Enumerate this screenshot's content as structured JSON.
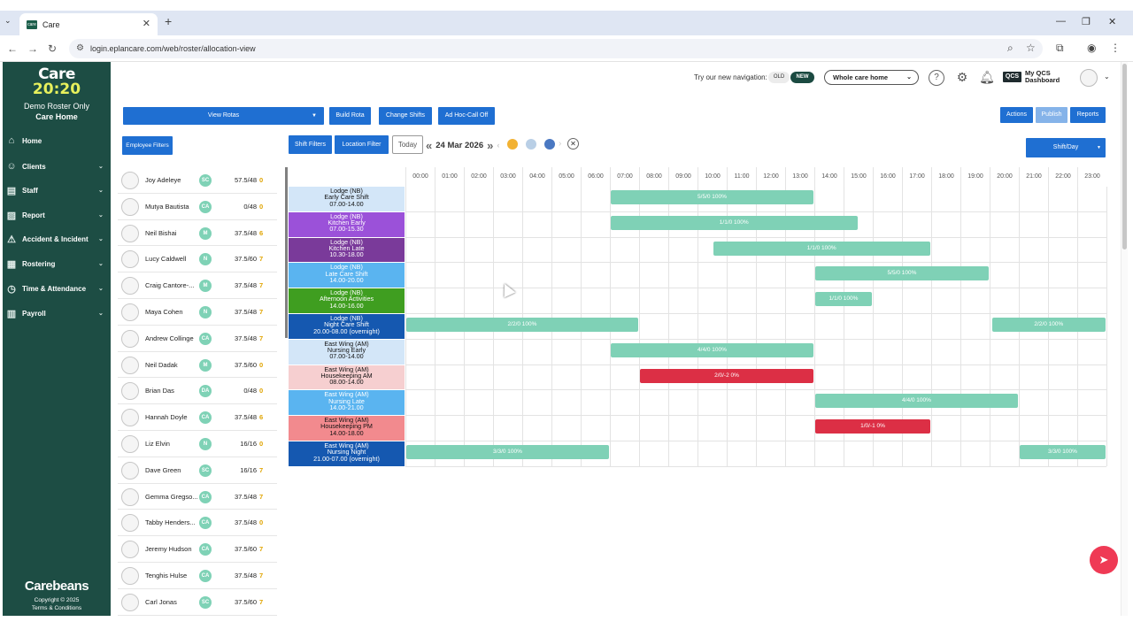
{
  "browser": {
    "tab_title": "Care",
    "favicon_text": "care",
    "url": "login.eplancare.com/web/roster/allocation-view"
  },
  "sidebar": {
    "logo_line1": "Care",
    "logo_line2_a": "20",
    "logo_line2_sep": ":",
    "logo_line2_b": "20",
    "org_line1": "Demo Roster Only",
    "org_line2": "Care Home",
    "items": [
      {
        "label": "Home",
        "icon": "home-icon",
        "chevron": false
      },
      {
        "label": "Clients",
        "icon": "clients-icon",
        "chevron": true
      },
      {
        "label": "Staff",
        "icon": "staff-icon",
        "chevron": true
      },
      {
        "label": "Report",
        "icon": "report-icon",
        "chevron": true
      },
      {
        "label": "Accident & Incident",
        "icon": "incident-icon",
        "chevron": true
      },
      {
        "label": "Rostering",
        "icon": "rostering-icon",
        "chevron": true
      },
      {
        "label": "Time & Attendance",
        "icon": "clock-icon",
        "chevron": true
      },
      {
        "label": "Payroll",
        "icon": "payroll-icon",
        "chevron": true
      }
    ],
    "brand": "Carebeans",
    "copyright": "Copyright © 2025",
    "terms": "Terms & Conditions"
  },
  "header": {
    "nav_prompt": "Try our new navigation:",
    "toggle_old": "OLD",
    "toggle_new": "NEW",
    "care_home_select": "Whole care home",
    "qcs_badge": "QCS",
    "qcs_label_1": "My QCS",
    "qcs_label_2": "Dashboard"
  },
  "toolbar": {
    "view_rotas": "View Rotas",
    "build_rota": "Build Rota",
    "change_shifts": "Change Shifts",
    "adhoc": "Ad Hoc-Call Off",
    "actions": "Actions",
    "publish": "Publish",
    "reports": "Reports",
    "employee_filters": "Employee Filters",
    "shift_filters": "Shift Filters",
    "location_filter": "Location Filter",
    "today": "Today",
    "date": "24 Mar 2026",
    "view_mode": "Shift/Day"
  },
  "dots": [
    {
      "color": "#f2b233"
    },
    {
      "color": "#b9cfe6"
    },
    {
      "color": "#4a78c2"
    }
  ],
  "staff": [
    {
      "name": "Joy Adeleye",
      "role": "SC",
      "hours": "57.5/48",
      "count": "0"
    },
    {
      "name": "Mutya Bautista",
      "role": "CA",
      "hours": "0/48",
      "count": "0"
    },
    {
      "name": "Neil Bishai",
      "role": "M",
      "hours": "37.5/48",
      "count": "6"
    },
    {
      "name": "Lucy Caldwell",
      "role": "N",
      "hours": "37.5/60",
      "count": "7"
    },
    {
      "name": "Craig Cantore-...",
      "role": "M",
      "hours": "37.5/48",
      "count": "7"
    },
    {
      "name": "Maya Cohen",
      "role": "N",
      "hours": "37.5/48",
      "count": "7"
    },
    {
      "name": "Andrew Collinge",
      "role": "CA",
      "hours": "37.5/48",
      "count": "7"
    },
    {
      "name": "Neil Dadak",
      "role": "M",
      "hours": "37.5/60",
      "count": "0"
    },
    {
      "name": "Brian Das",
      "role": "DA",
      "hours": "0/48",
      "count": "0"
    },
    {
      "name": "Hannah Doyle",
      "role": "CA",
      "hours": "37.5/48",
      "count": "6"
    },
    {
      "name": "Liz Elvin",
      "role": "N",
      "hours": "16/16",
      "count": "0"
    },
    {
      "name": "Dave Green",
      "role": "SC",
      "hours": "16/16",
      "count": "7"
    },
    {
      "name": "Gemma Gregso...",
      "role": "CA",
      "hours": "37.5/48",
      "count": "7"
    },
    {
      "name": "Tabby Henders...",
      "role": "CA",
      "hours": "37.5/48",
      "count": "0"
    },
    {
      "name": "Jeremy Hudson",
      "role": "CA",
      "hours": "37.5/60",
      "count": "7"
    },
    {
      "name": "Tenghis Hulse",
      "role": "CA",
      "hours": "37.5/48",
      "count": "7"
    },
    {
      "name": "Carl Jonas",
      "role": "SC",
      "hours": "37.5/60",
      "count": "7"
    }
  ],
  "hours": [
    "00:00",
    "01:00",
    "02:00",
    "03:00",
    "04:00",
    "05:00",
    "06:00",
    "07:00",
    "08:00",
    "09:00",
    "10:00",
    "11:00",
    "12:00",
    "13:00",
    "14:00",
    "15:00",
    "16:00",
    "17:00",
    "18:00",
    "19:00",
    "20:00",
    "21:00",
    "22:00",
    "23:00"
  ],
  "shifts": [
    {
      "line1": "Lodge (NB)",
      "line2": "Early Care Shift",
      "line3": "07.00-14.00",
      "bg": "#d3e6f8",
      "fg": "#111",
      "bars": [
        {
          "start": 7,
          "end": 14,
          "label": "5/5/0 100%",
          "status": "ok"
        }
      ]
    },
    {
      "line1": "Lodge (NB)",
      "line2": "Kitchen Early",
      "line3": "07.00-15.30",
      "bg": "#9b51d9",
      "fg": "#fff",
      "bars": [
        {
          "start": 7,
          "end": 15.5,
          "label": "1/1/0 100%",
          "status": "ok"
        }
      ]
    },
    {
      "line1": "Lodge (NB)",
      "line2": "Kitchen Late",
      "line3": "10.30-18.00",
      "bg": "#7a3a9a",
      "fg": "#fff",
      "bars": [
        {
          "start": 10.5,
          "end": 18,
          "label": "1/1/0 100%",
          "status": "ok"
        }
      ]
    },
    {
      "line1": "Lodge (NB)",
      "line2": "Late Care Shift",
      "line3": "14.00-20.00",
      "bg": "#5ab4f0",
      "fg": "#fff",
      "bars": [
        {
          "start": 14,
          "end": 20,
          "label": "5/5/0 100%",
          "status": "ok"
        }
      ]
    },
    {
      "line1": "Lodge (NB)",
      "line2": "Afternoon Activities",
      "line3": "14.00-16.00",
      "bg": "#3f9e20",
      "fg": "#fff",
      "bars": [
        {
          "start": 14,
          "end": 16,
          "label": "1/1/0 100%",
          "status": "ok"
        }
      ]
    },
    {
      "line1": "Lodge (NB)",
      "line2": "Night Care Shift",
      "line3": "20.00-08.00 (overnight)",
      "bg": "#1558b0",
      "fg": "#fff",
      "bars": [
        {
          "start": 0,
          "end": 8,
          "label": "2/2/0 100%",
          "status": "ok"
        },
        {
          "start": 20.05,
          "end": 24,
          "label": "2/2/0 100%",
          "status": "ok"
        }
      ]
    },
    {
      "line1": "East Wing (AM)",
      "line2": "Nursing Early",
      "line3": "07.00-14.00",
      "bg": "#d3e6f8",
      "fg": "#111",
      "bars": [
        {
          "start": 7,
          "end": 14,
          "label": "4/4/0 100%",
          "status": "ok"
        }
      ]
    },
    {
      "line1": "East Wing (AM)",
      "line2": "Housekeeping AM",
      "line3": "08.00-14.00",
      "bg": "#f6cfd0",
      "fg": "#111",
      "bars": [
        {
          "start": 8,
          "end": 14,
          "label": "2/0/-2 0%",
          "status": "bad"
        }
      ]
    },
    {
      "line1": "East Wing (AM)",
      "line2": "Nursing Late",
      "line3": "14.00-21.00",
      "bg": "#5ab4f0",
      "fg": "#fff",
      "bars": [
        {
          "start": 14,
          "end": 21,
          "label": "4/4/0 100%",
          "status": "ok"
        }
      ]
    },
    {
      "line1": "East Wing (AM)",
      "line2": "Housekeeping PM",
      "line3": "14.00-18.00",
      "bg": "#f28a8e",
      "fg": "#111",
      "bars": [
        {
          "start": 14,
          "end": 18,
          "label": "1/0/-1 0%",
          "status": "bad"
        }
      ]
    },
    {
      "line1": "East Wing (AM)",
      "line2": "Nursing Night",
      "line3": "21.00-07.00 (overnight)",
      "bg": "#1558b0",
      "fg": "#fff",
      "bars": [
        {
          "start": 0,
          "end": 7,
          "label": "3/3/0 100%",
          "status": "ok"
        },
        {
          "start": 21,
          "end": 24,
          "label": "3/3/0 100%",
          "status": "ok"
        }
      ]
    }
  ]
}
